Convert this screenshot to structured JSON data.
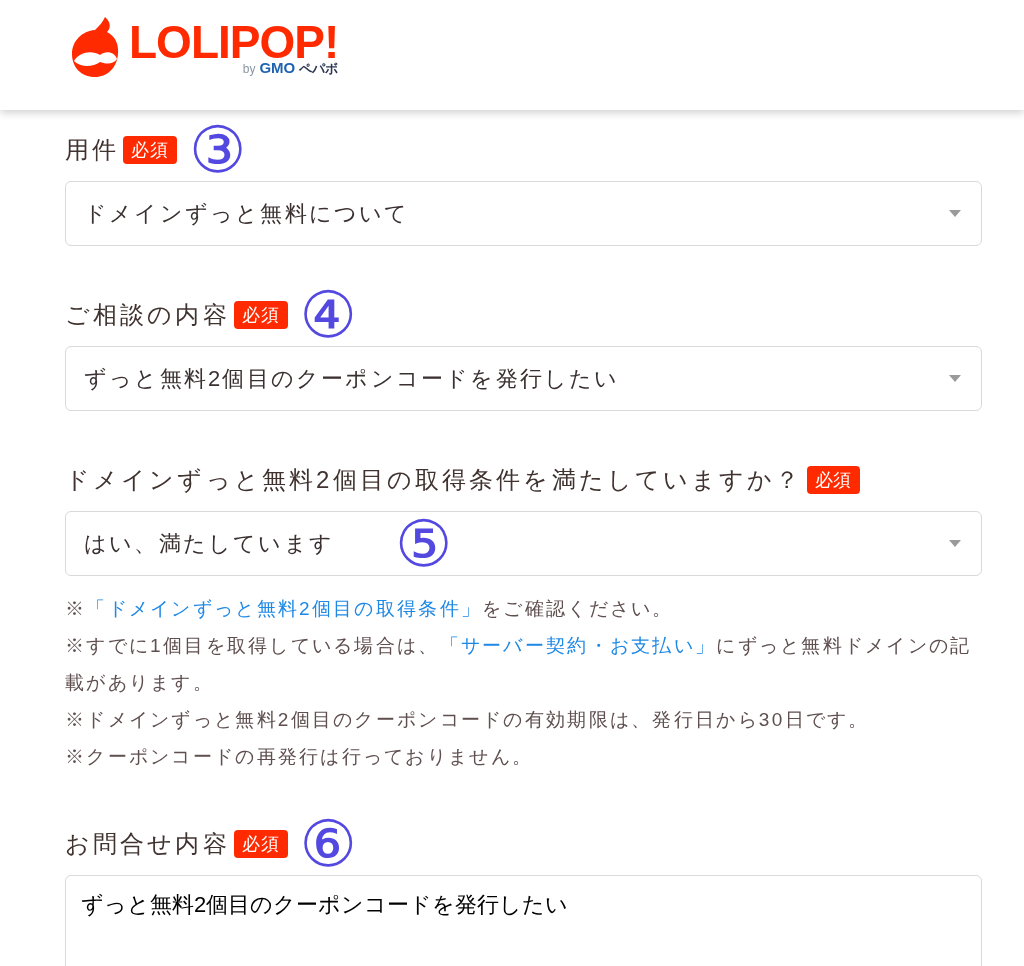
{
  "header": {
    "logo": {
      "wordmark": "LOLIPOP!",
      "by": "by",
      "company_1": "GMO",
      "company_2": "ペパボ"
    }
  },
  "fields": [
    {
      "kind": "select",
      "label": "用件",
      "badge": "必須",
      "value": "ドメインずっと無料について",
      "annotation": {
        "kind": "inline",
        "text": "③"
      }
    },
    {
      "kind": "select",
      "label": "ご相談の内容",
      "badge": "必須",
      "value": "ずっと無料2個目のクーポンコードを発行したい",
      "annotation": {
        "kind": "inline",
        "text": "④"
      }
    },
    {
      "kind": "select",
      "label": "ドメインずっと無料2個目の取得条件を満たしていますか？",
      "badge": "必須",
      "value": "はい、満たしています",
      "annotation": {
        "kind": "overlay",
        "text": "⑤"
      },
      "notes": [
        {
          "segments": [
            {
              "kind": "text",
              "text": "※"
            },
            {
              "kind": "link",
              "text": "「ドメインずっと無料2個目の取得条件」"
            },
            {
              "kind": "text",
              "text": "をご確認ください。"
            }
          ]
        },
        {
          "segments": [
            {
              "kind": "text",
              "text": "※すでに1個目を取得している場合は、"
            },
            {
              "kind": "link",
              "text": "「サーバー契約・お支払い」"
            },
            {
              "kind": "text",
              "text": "にずっと無料ドメインの記載があります。"
            }
          ]
        },
        {
          "segments": [
            {
              "kind": "text",
              "text": "※ドメインずっと無料2個目のクーポンコードの有効期限は、発行日から30日です。"
            }
          ]
        },
        {
          "segments": [
            {
              "kind": "text",
              "text": "※クーポンコードの再発行は行っておりません。"
            }
          ]
        }
      ]
    },
    {
      "kind": "textarea",
      "label": "お問合せ内容",
      "badge": "必須",
      "value": "ずっと無料2個目のクーポンコードを発行したい",
      "annotation": {
        "kind": "inline",
        "text": "⑥"
      }
    }
  ]
}
